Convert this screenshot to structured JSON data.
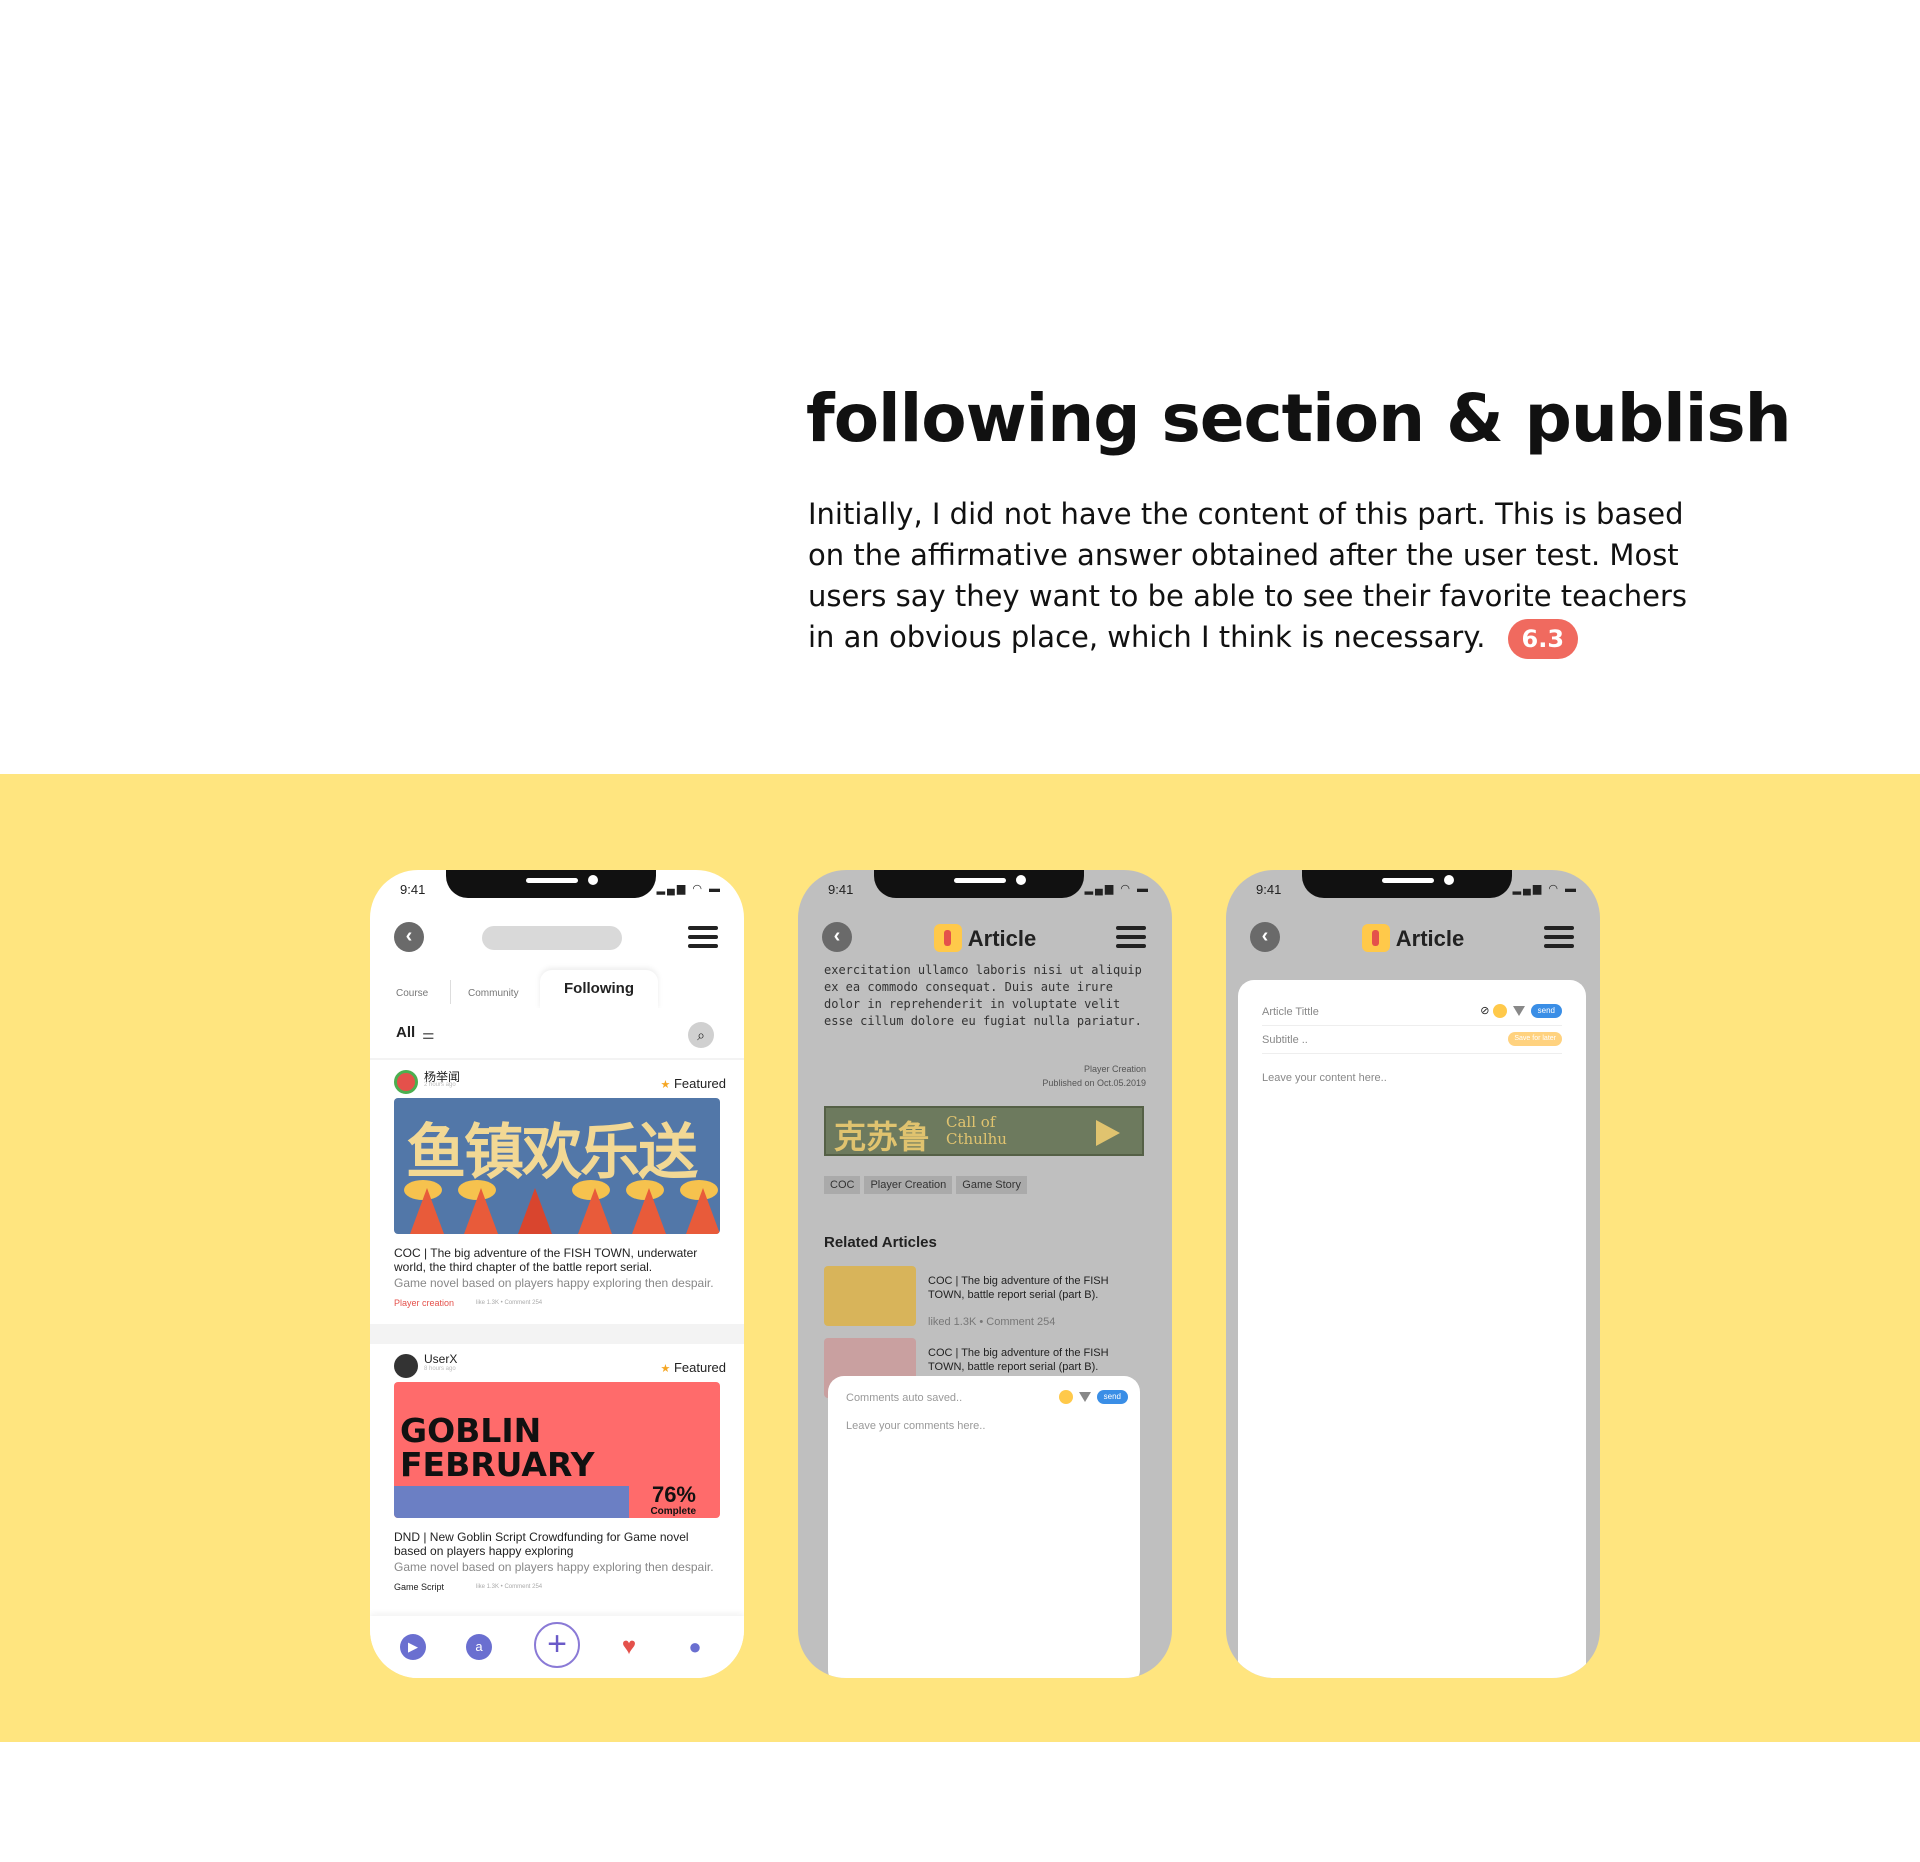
{
  "header": {
    "title": "following section & publish",
    "body": "Initially, I did not have the content of this part. This is based on the affirmative answer obtained after the user test. Most users say they want to be able to see their favorite teachers in an obvious place, which I think is necessary.",
    "badge": "6.3"
  },
  "colors": {
    "band": "#ffe57f",
    "badge": "#f06a5f",
    "accent": "#e4514b",
    "send": "#3a8ee6"
  },
  "status": {
    "time": "9:41",
    "icons": "signal-icon wifi-icon battery-icon"
  },
  "phone1": {
    "tabs": {
      "course": "Course",
      "community": "Community",
      "following": "Following"
    },
    "filter": {
      "all": "All"
    },
    "card1": {
      "user": "杨举闻",
      "time": "2 hours ago",
      "featured": "Featured",
      "image_text": "鱼镇欢乐送",
      "title": "COC | The big adventure of the FISH TOWN, underwater world, the third chapter of the battle report serial.",
      "desc": "Game novel based on players happy exploring then despair.",
      "tag": "Player creation",
      "stats": "like 1.3K  •  Comment 254"
    },
    "card2": {
      "user": "UserX",
      "time": "8 hours ago",
      "featured": "Featured",
      "image_title": "GOBLIN FEBRUARY",
      "progress": 76,
      "progress_label": "76%",
      "complete": "Complete",
      "title": "DND | New Goblin Script Crowdfunding for Game novel based on players happy exploring",
      "desc": "Game novel based on players happy exploring then despair.",
      "tag": "Game Script",
      "stats": "like 1.3K  •  Comment 254"
    },
    "tabbar": [
      "play-icon",
      "store-icon",
      "add-icon",
      "heart-icon",
      "profile-icon"
    ]
  },
  "phone2": {
    "title": "Article",
    "lorem": "exercitation ullamco laboris nisi ut aliquip ex ea commodo consequat. Duis aute irure dolor in reprehenderit in voluptate velit esse cillum dolore eu fugiat nulla pariatur.",
    "meta_author": "Player Creation",
    "meta_date": "Published on Oct.05.2019",
    "video_cn": "克苏鲁",
    "video_en": "Call of Cthulhu",
    "chips": [
      "COC",
      "Player Creation",
      "Game Story"
    ],
    "related_heading": "Related Articles",
    "related": [
      {
        "title": "COC | The big adventure of the FISH TOWN, battle report serial (part B).",
        "stats": "liked 1.3K  •  Comment 254"
      },
      {
        "title": "COC | The big adventure of the FISH TOWN, battle report serial (part B).",
        "stats": ""
      }
    ],
    "comment": {
      "saved": "Comments auto saved..",
      "send": "send",
      "placeholder": "Leave your comments here.."
    }
  },
  "phone3": {
    "title": "Article",
    "article_title": "Article Tittle",
    "subtitle": "Subtitle ..",
    "send": "send",
    "save_later": "Save for later",
    "content_placeholder": "Leave your content here.."
  }
}
